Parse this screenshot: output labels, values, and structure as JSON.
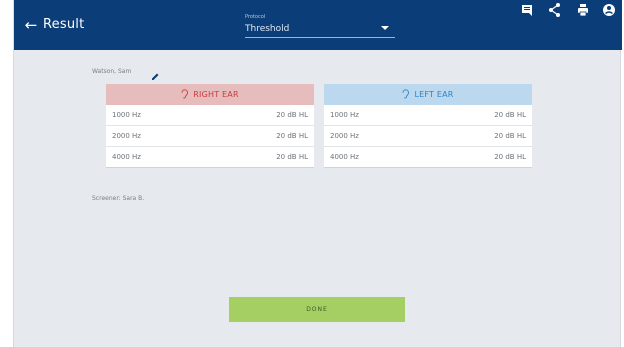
{
  "appbar": {
    "back_icon": "arrow-left-icon",
    "title": "Result",
    "protocol": {
      "label": "Protocol",
      "value": "Threshold"
    },
    "actions": [
      "comment-icon",
      "share-icon",
      "print-icon",
      "account-icon"
    ]
  },
  "patient": {
    "name": "Watson, Sam",
    "edit_icon": "pencil-icon"
  },
  "ears": {
    "right": {
      "title": "RIGHT EAR",
      "icon": "ear-icon",
      "color": "#c63c3c",
      "rows": [
        {
          "freq": "1000 Hz",
          "level": "20 dB HL"
        },
        {
          "freq": "2000 Hz",
          "level": "20 dB HL"
        },
        {
          "freq": "4000 Hz",
          "level": "20 dB HL"
        }
      ]
    },
    "left": {
      "title": "LEFT EAR",
      "icon": "ear-icon",
      "color": "#2a84c9",
      "rows": [
        {
          "freq": "1000 Hz",
          "level": "20 dB HL"
        },
        {
          "freq": "2000 Hz",
          "level": "20 dB HL"
        },
        {
          "freq": "4000 Hz",
          "level": "20 dB HL"
        }
      ]
    }
  },
  "screener": "Screener: Sara B.",
  "done_label": "DONE",
  "colors": {
    "appbar": "#0b3e78",
    "done": "#a6cf63"
  }
}
